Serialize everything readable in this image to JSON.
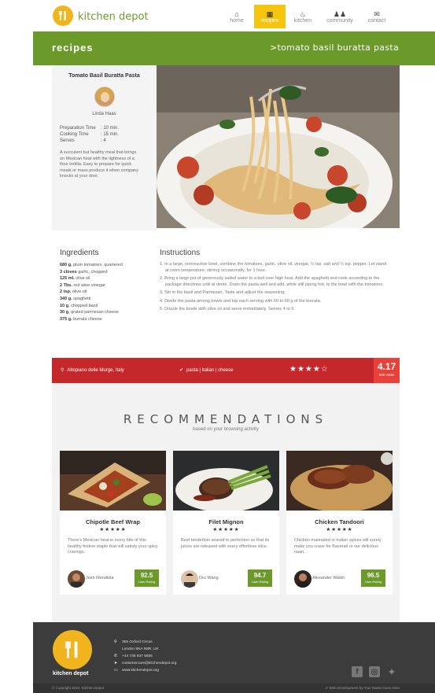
{
  "header": {
    "brand": "kitchen depot",
    "nav": [
      {
        "label": "home",
        "icon": "home-icon",
        "glyph": "⌂"
      },
      {
        "label": "recipes",
        "icon": "recipes-icon",
        "glyph": "▦"
      },
      {
        "label": "kitchen",
        "icon": "kitchen-icon",
        "glyph": "♨"
      },
      {
        "label": "community",
        "icon": "community-icon",
        "glyph": "♟♟"
      },
      {
        "label": "contact",
        "icon": "contact-icon",
        "glyph": "✉"
      }
    ],
    "active_nav": "recipes"
  },
  "banner": {
    "title": "recipes",
    "breadcrumb": "tomato basil buratta pasta"
  },
  "recipe": {
    "title": "Tomato Basil Buratta Pasta",
    "author": "Linda Haas",
    "meta": [
      {
        "key": "Preparation Time",
        "value": ": 10 min."
      },
      {
        "key": "Cooking Time",
        "value": ": 15 min."
      },
      {
        "key": "Serves",
        "value": ": 4"
      }
    ],
    "description": "A succulent but healthy meal that brings on Mexican heat with the lightness of a flour tortilla. Easy to prepare for quick meals or mass produce it when company knocks at your door."
  },
  "ingredients": {
    "heading": "Ingredients",
    "items": [
      {
        "qty": "680 g.",
        "name": "plum tomatoes, quartered"
      },
      {
        "qty": "3 cloves",
        "name": "garlic, chopped"
      },
      {
        "qty": "125 ml.",
        "name": "olive oil"
      },
      {
        "qty": "2 Tbs.",
        "name": "red wine vinegar"
      },
      {
        "qty": "2 tsp.",
        "name": "olive oil"
      },
      {
        "qty": "340 g.",
        "name": "spaghetti"
      },
      {
        "qty": "10 g.",
        "name": "chopped basil"
      },
      {
        "qty": "30 g.",
        "name": "grated parmesan cheese"
      },
      {
        "qty": "375 g.",
        "name": "burrata cheese"
      }
    ]
  },
  "instructions": {
    "heading": "Instructions",
    "steps": [
      "1. In a large, nonreactive bowl, combine the tomatoes, garlic, olive oil, vinegar, ½ tsp. salt and ¼ tsp. pepper. Let stand at room temperature, stirring occasionally, for 1 hour.",
      "2. Bring a large pot of generously salted water to a boil over high heat. Add the spaghetti and cook according to the package directions until al dente. Drain the pasta well and add, while still piping hot, to the bowl with the tomatoes.",
      "3. Stir in the basil and Parmesan. Taste and adjust the seasoning.",
      "4. Divide the pasta among bowls and top each serving with 60 to 90 g of the burrata.",
      "5. Drizzle the bowls with olive oil and serve immediately. Serves 4 to 6."
    ]
  },
  "infobar": {
    "location": "Altopiano delle Murge, Italy",
    "tags": "pasta | italian | cheese",
    "stars": "★★★★☆",
    "score": "4.17",
    "votes": "529 votes"
  },
  "recommendations": {
    "title": "RECOMMENDATIONS",
    "subtitle": "based on your browsing activity",
    "cards": [
      {
        "name": "Chipotle Beef Wrap",
        "stars": "★★★★★",
        "desc": "There's Mexican heat in every bite of this healthy festive staple that will satisfy your spicy cravings.",
        "author": "Josh Mendiola",
        "rating": "92.5",
        "rating_label": "User Rating"
      },
      {
        "name": "Filet Mignon",
        "stars": "★★★★★",
        "desc": "Beef tenderloin seared to perfection so that its juices are released with every effortless slice.",
        "author": "Dru Wang",
        "rating": "94.7",
        "rating_label": "User Rating"
      },
      {
        "name": "Chicken Tandoori",
        "stars": "★★★★★",
        "desc": "Chicken marinated in Indian spices will surely make you crave for Basmati or our delicious naan.",
        "author": "Alexander Walsh",
        "rating": "96.5",
        "rating_label": "User Rating"
      }
    ]
  },
  "footer": {
    "brand": "kitchen depot",
    "address_line1": "365 Oxford Circus",
    "address_line2": "London 8NA N8R, UK",
    "phone": "+44 736 937 5655",
    "email": "customercare@kitchendepot.org",
    "website": "www.kitchendepot.org",
    "copyright": "© Copyright 2020, Kitchen Depot",
    "credit": "Web Development by Your Name Goes Here"
  },
  "colors": {
    "brand_green": "#6b9a2b",
    "nav_active": "#f4c40f",
    "info_red": "#c5282a",
    "score_red": "#e8413a",
    "logo_yellow": "#f0b41e"
  }
}
